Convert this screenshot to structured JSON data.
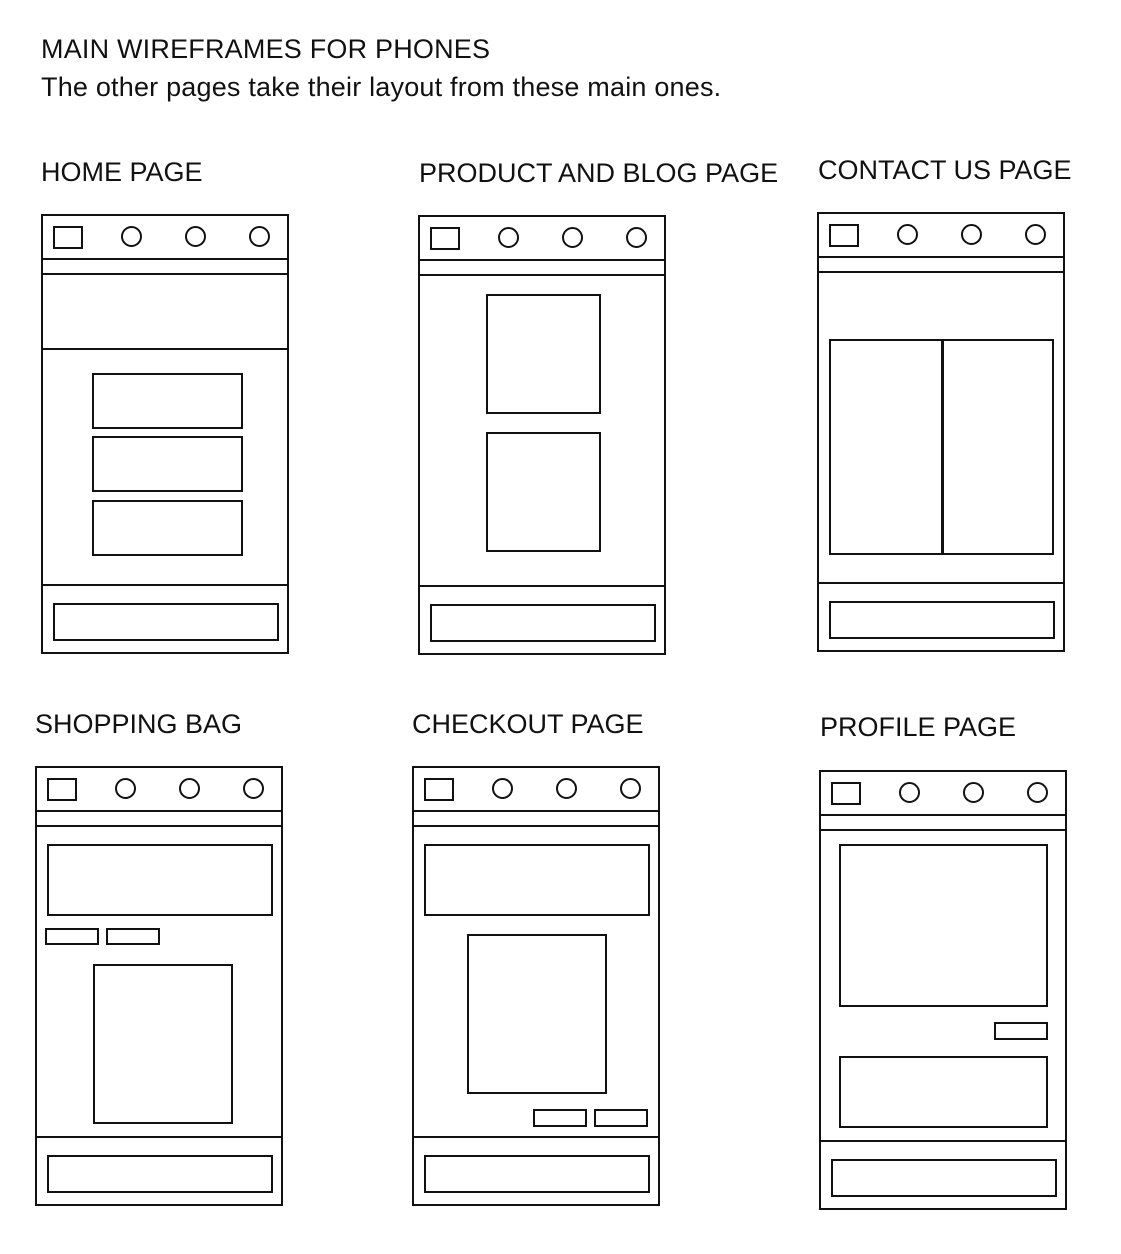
{
  "heading": {
    "title": "MAIN WIREFRAMES FOR PHONES",
    "subtitle": "The other pages take their layout from these main ones."
  },
  "wireframes": [
    {
      "label": "HOME PAGE"
    },
    {
      "label": "PRODUCT AND BLOG PAGE"
    },
    {
      "label": "CONTACT US PAGE"
    },
    {
      "label": "SHOPPING BAG"
    },
    {
      "label": "CHECKOUT PAGE"
    },
    {
      "label": "PROFILE PAGE"
    }
  ]
}
